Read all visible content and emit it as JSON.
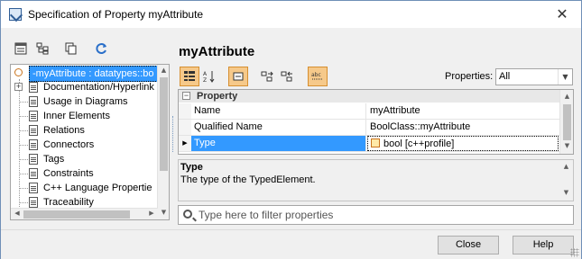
{
  "window": {
    "title": "Specification of Property myAttribute",
    "close_glyph": "✕"
  },
  "left_toolbar": {
    "icons": [
      "list-view-icon",
      "tree-structure-icon",
      "copy-icon",
      "refresh-icon"
    ]
  },
  "tree": {
    "root_label": "-myAttribute : datatypes::bo",
    "items": [
      "Documentation/Hyperlink",
      "Usage in Diagrams",
      "Inner Elements",
      "Relations",
      "Connectors",
      "Tags",
      "Constraints",
      "C++ Language Propertie",
      "Traceability"
    ]
  },
  "main": {
    "element_name": "myAttribute",
    "properties_label": "Properties:",
    "properties_filter": "All",
    "grid": {
      "group_label": "Property",
      "rows": [
        {
          "name": "Name",
          "value": "myAttribute"
        },
        {
          "name": "Qualified Name",
          "value": "BoolClass::myAttribute"
        },
        {
          "name": "Type",
          "value": "bool [c++profile]"
        }
      ]
    },
    "description": {
      "title": "Type",
      "text": "The type of the TypedElement."
    },
    "filter": {
      "placeholder": "Type here to filter properties",
      "value": ""
    }
  },
  "footer": {
    "close_label": "Close",
    "help_label": "Help"
  },
  "colors": {
    "selection": "#3399ff",
    "toolbar_active": "#f6c98a"
  }
}
